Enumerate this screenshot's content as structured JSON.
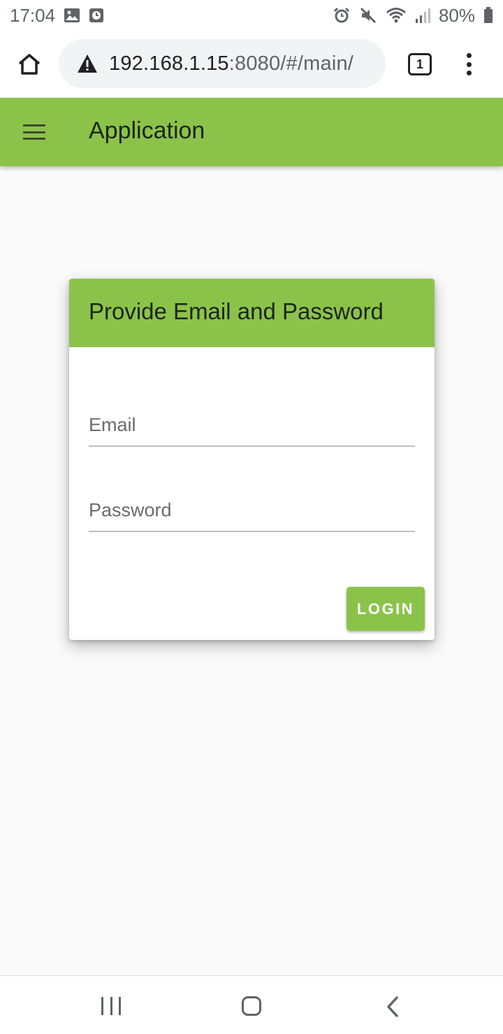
{
  "status_bar": {
    "time": "17:04",
    "battery": "80%",
    "icons": [
      "image-icon",
      "clock-app-icon",
      "alarm-icon",
      "mute-icon",
      "wifi-icon",
      "signal-icon",
      "battery-icon"
    ]
  },
  "browser": {
    "url_host": "192.168.1.15",
    "url_rest": ":8080/#/main/",
    "tab_count": "1",
    "icons": [
      "home-icon",
      "warning-icon",
      "tabs-icon",
      "more-vert-icon"
    ]
  },
  "app": {
    "title": "Application",
    "accent_color": "#8bc34a"
  },
  "login_card": {
    "title": "Provide Email and Password",
    "email_placeholder": "Email",
    "email_value": "",
    "password_placeholder": "Password",
    "password_value": "",
    "login_label": "LOGIN"
  },
  "nav_bar": {
    "icons": [
      "recent-apps-icon",
      "home-nav-icon",
      "back-icon"
    ]
  }
}
